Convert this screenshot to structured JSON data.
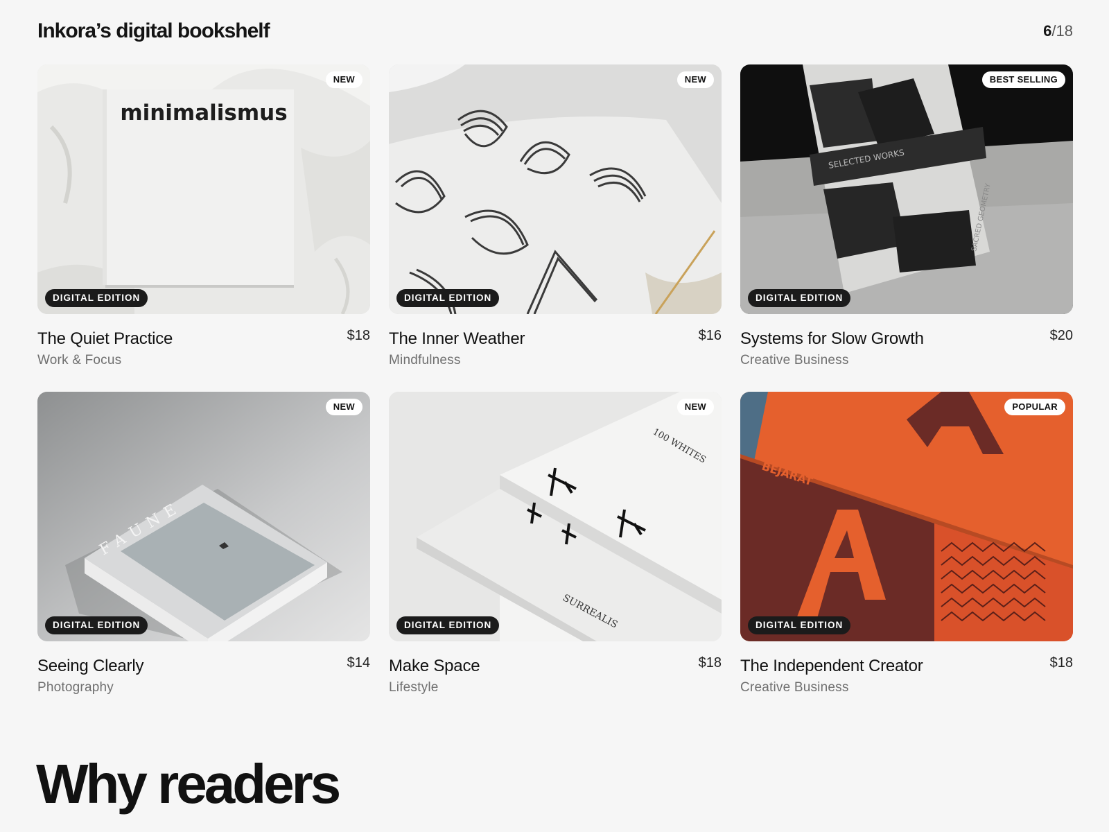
{
  "header": {
    "title": "Inkora’s digital bookshelf",
    "counter_current": "6",
    "counter_total": "/18"
  },
  "books": [
    {
      "title": "The Quiet Practice",
      "category": "Work & Focus",
      "price": "$18",
      "badge": "NEW",
      "edition": "DIGITAL EDITION",
      "cover_text": "minimalismus"
    },
    {
      "title": "The Inner Weather",
      "category": "Mindfulness",
      "price": "$16",
      "badge": "NEW",
      "edition": "DIGITAL EDITION"
    },
    {
      "title": "Systems for Slow Growth",
      "category": "Creative Business",
      "price": "$20",
      "badge": "BEST SELLING",
      "edition": "DIGITAL EDITION",
      "cover_text": "SELECTED WORKS",
      "cover_text2": "SACRED GEOMETRY"
    },
    {
      "title": "Seeing Clearly",
      "category": "Photography",
      "price": "$14",
      "badge": "NEW",
      "edition": "DIGITAL EDITION",
      "cover_text": "FAUNE"
    },
    {
      "title": "Make Space",
      "category": "Lifestyle",
      "price": "$18",
      "badge": "NEW",
      "edition": "DIGITAL EDITION",
      "cover_text": "100 WHITES",
      "cover_text2": "SURREALIS"
    },
    {
      "title": "The Independent Creator",
      "category": "Creative Business",
      "price": "$18",
      "badge": "POPULAR",
      "edition": "DIGITAL EDITION",
      "cover_text": "BEJARAT"
    }
  ],
  "section": {
    "heading": "Why readers"
  }
}
